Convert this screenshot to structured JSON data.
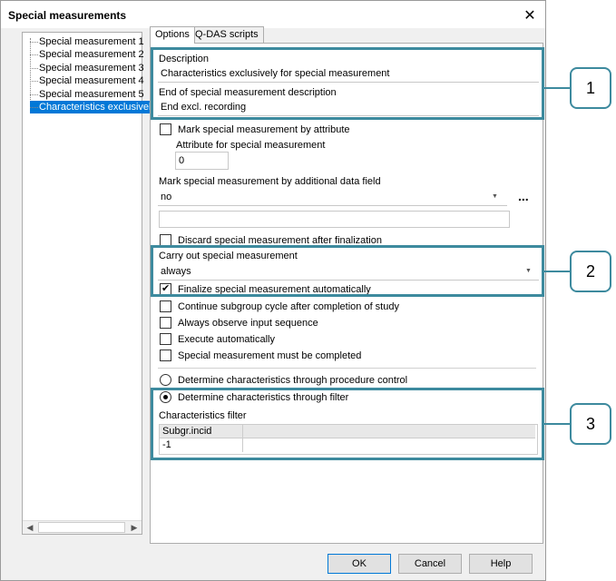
{
  "window": {
    "title": "Special measurements"
  },
  "tree": {
    "items": [
      "Special measurement 1",
      "Special measurement 2",
      "Special measurement 3",
      "Special measurement 4",
      "Special measurement 5",
      "Characteristics exclusively"
    ],
    "selected_index": 5
  },
  "tabs": [
    {
      "label": "Options"
    },
    {
      "label": "Q-DAS scripts"
    }
  ],
  "options": {
    "description_label": "Description",
    "description_value": "Characteristics exclusively for special measurement",
    "end_label": "End of special measurement description",
    "end_value": "End excl. recording",
    "mark_by_attribute_label": "Mark special measurement by attribute",
    "mark_by_attribute_checked": false,
    "attribute_label": "Attribute for special measurement",
    "attribute_value": "0",
    "mark_by_field_label": "Mark special measurement by additional data field",
    "mark_by_field_value": "no",
    "more_button": "...",
    "extra_field_value": "",
    "discard_label": "Discard special measurement after finalization",
    "discard_checked": false,
    "carry_out_label": "Carry out special measurement",
    "carry_out_value": "always",
    "finalize_label": "Finalize special measurement automatically",
    "finalize_checked": true,
    "continue_label": "Continue subgroup cycle after completion of study",
    "observe_label": "Always observe input sequence",
    "execute_label": "Execute automatically",
    "must_complete_label": "Special measurement must be completed",
    "radio_procedure_label": "Determine characteristics through procedure control",
    "radio_filter_label": "Determine characteristics through filter",
    "radio_selected": "filter",
    "filter_label": "Characteristics filter",
    "filter_table": {
      "header": "Subgr.incid",
      "value": "-1"
    }
  },
  "buttons": {
    "ok": "OK",
    "cancel": "Cancel",
    "help": "Help"
  },
  "callouts": [
    "1",
    "2",
    "3"
  ],
  "highlight_color": "#3d8a9e",
  "selection_color": "#0078d7"
}
